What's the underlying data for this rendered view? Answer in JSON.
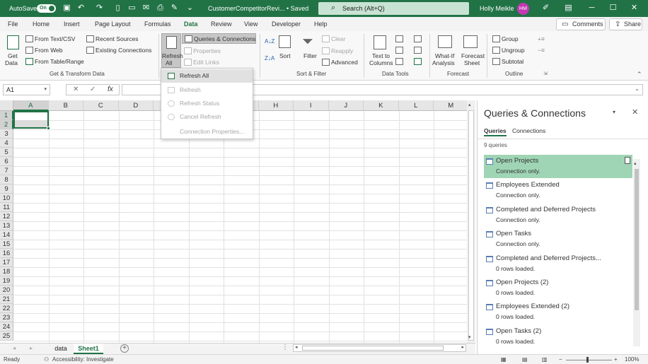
{
  "titlebar": {
    "autosave_label": "AutoSave",
    "autosave_state": "On",
    "file_name": "CustomerCompetitorRevi... • Saved",
    "search_placeholder": "Search (Alt+Q)",
    "user_name": "Holly Meikle",
    "user_initials": "HM"
  },
  "menu": {
    "tabs": [
      "File",
      "Home",
      "Insert",
      "Page Layout",
      "Formulas",
      "Data",
      "Review",
      "View",
      "Developer",
      "Help"
    ],
    "active": "Data",
    "comments_label": "Comments",
    "share_label": "Share"
  },
  "ribbon": {
    "get_data": "Get",
    "get_data2": "Data",
    "from_text_csv": "From Text/CSV",
    "from_web": "From Web",
    "from_table_range": "From Table/Range",
    "recent_sources": "Recent Sources",
    "existing_connections": "Existing Connections",
    "group_get_transform": "Get & Transform Data",
    "refresh_all": "Refresh",
    "refresh_all2": "All",
    "queries_connections": "Queries & Connections",
    "properties": "Properties",
    "edit_links": "Edit Links",
    "sort_label": "Sort",
    "filter_label": "Filter",
    "clear_label": "Clear",
    "reapply_label": "Reapply",
    "advanced_label": "Advanced",
    "group_sort_filter": "Sort & Filter",
    "text_to_columns": "Text to",
    "text_to_columns2": "Columns",
    "group_data_tools": "Data Tools",
    "what_if": "What-If",
    "what_if2": "Analysis",
    "forecast_sheet": "Forecast",
    "forecast_sheet2": "Sheet",
    "group_forecast": "Forecast",
    "group_label": "Group",
    "ungroup_label": "Ungroup",
    "subtotal_label": "Subtotal",
    "group_outline": "Outline"
  },
  "refresh_menu": {
    "items": [
      "Refresh All",
      "Refresh",
      "Refresh Status",
      "Cancel Refresh",
      "Connection Properties..."
    ]
  },
  "formula_bar": {
    "name_box": "A1",
    "cancel": "✕",
    "enter": "✓",
    "fx": "fx",
    "value": ""
  },
  "grid": {
    "columns": [
      "A",
      "B",
      "C",
      "D",
      "E",
      "F",
      "G",
      "H",
      "I",
      "J",
      "K",
      "L",
      "M"
    ],
    "rows": [
      "1",
      "2",
      "3",
      "4",
      "5",
      "6",
      "7",
      "8",
      "9",
      "10",
      "11",
      "12",
      "13",
      "14",
      "15",
      "16",
      "17",
      "18",
      "19",
      "20",
      "21",
      "22",
      "23",
      "24",
      "25"
    ],
    "selected_column": "A",
    "selected_rows": [
      "1",
      "2"
    ]
  },
  "sheets": {
    "tabs": [
      "data",
      "Sheet1"
    ],
    "active": "Sheet1",
    "add": "+"
  },
  "statusbar": {
    "ready": "Ready",
    "accessibility": "Accessibility: Investigate",
    "zoom": "100%"
  },
  "panel": {
    "title": "Queries & Connections",
    "tab_queries": "Queries",
    "tab_connections": "Connections",
    "count": "9 queries",
    "items": [
      {
        "name": "Open Projects",
        "status": "Connection only."
      },
      {
        "name": "Employees Extended",
        "status": "Connection only."
      },
      {
        "name": "Completed and Deferred Projects",
        "status": "Connection only."
      },
      {
        "name": "Open Tasks",
        "status": "Connection only."
      },
      {
        "name": "Completed and Deferred Projects...",
        "status": "0 rows loaded."
      },
      {
        "name": "Open Projects (2)",
        "status": "0 rows loaded."
      },
      {
        "name": "Employees Extended (2)",
        "status": "0 rows loaded."
      },
      {
        "name": "Open Tasks (2)",
        "status": "0 rows loaded."
      }
    ]
  },
  "colors": {
    "accent": "#217346",
    "selected_query": "#9fd5b5"
  }
}
